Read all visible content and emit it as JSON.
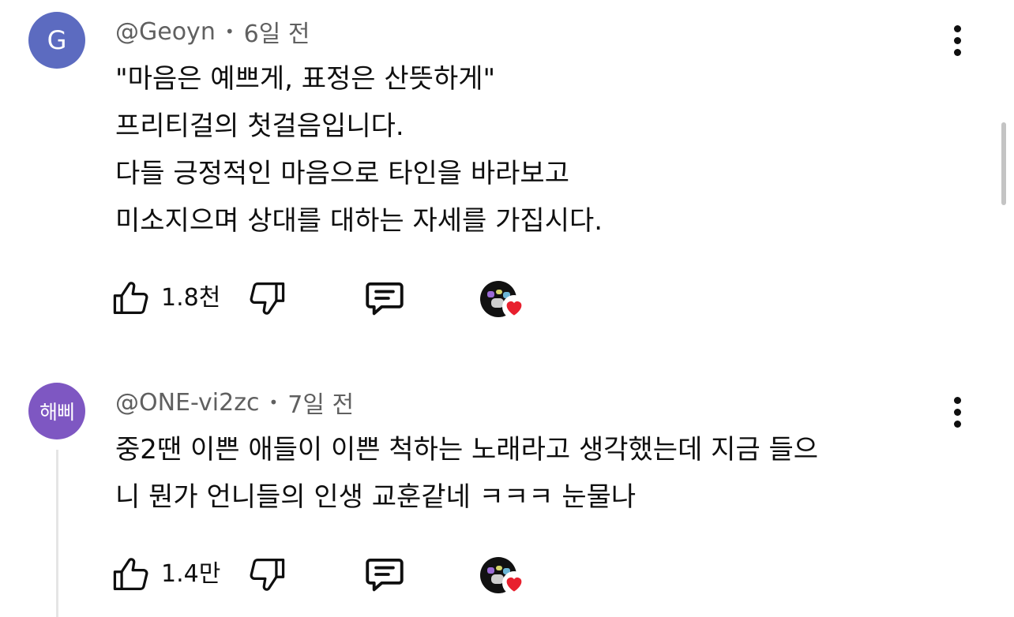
{
  "comments": [
    {
      "avatar_text": "G",
      "avatar_color": "#5c6bc0",
      "author": "@Geoyn",
      "separator": "•",
      "time": "6일 전",
      "lines": [
        "\"마음은 예쁘게, 표정은 산뜻하게\"",
        "프리티걸의 첫걸음입니다.",
        "다들 긍정적인 마음으로 타인을 바라보고",
        "미소지으며 상대를 대하는 자세를 가집시다."
      ],
      "like_count": "1.8천",
      "hearted_by_creator": true,
      "icons": [
        "thumbs-up-icon",
        "thumbs-down-icon",
        "reply-icon",
        "more-vert-icon"
      ]
    },
    {
      "avatar_text": "해삐",
      "avatar_color": "#7e57c2",
      "author": "@ONE-vi2zc",
      "separator": "•",
      "time": "7일 전",
      "lines": [
        "중2땐 이쁜 애들이 이쁜 척하는 노래라고 생각했는데 지금 들으",
        "니 뭔가 언니들의 인생 교훈같네 ㅋㅋㅋ 눈물나"
      ],
      "like_count": "1.4만",
      "hearted_by_creator": true,
      "icons": [
        "thumbs-up-icon",
        "thumbs-down-icon",
        "reply-icon",
        "more-vert-icon"
      ]
    }
  ],
  "colors": {
    "heart": "#e8202e",
    "secondary_text": "#606060"
  }
}
